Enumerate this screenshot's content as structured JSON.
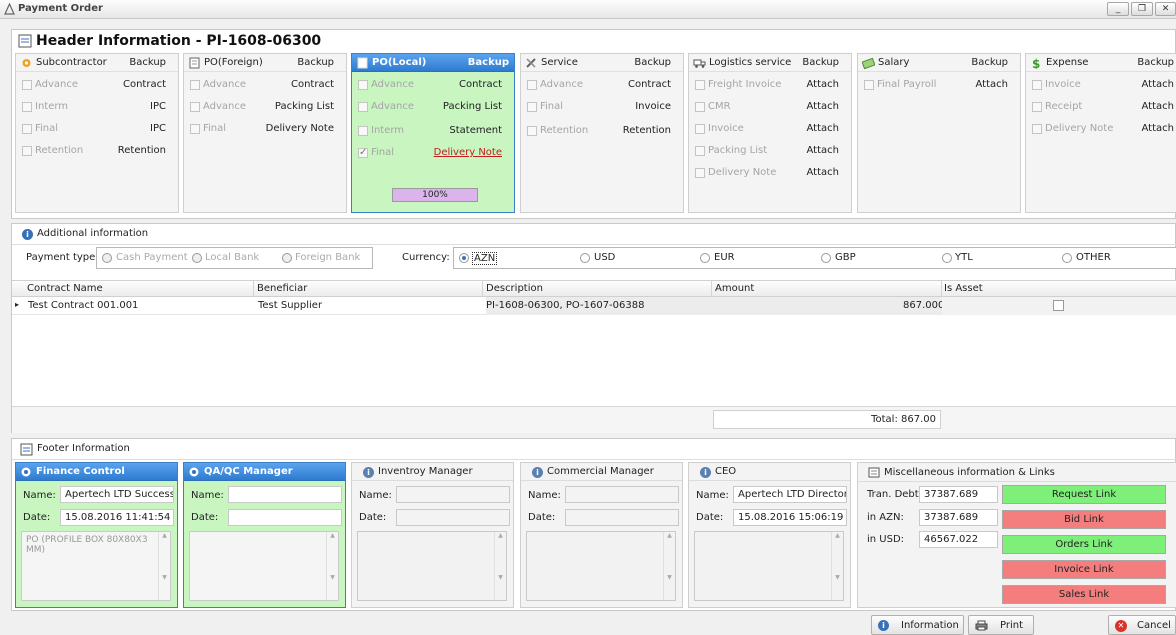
{
  "window": {
    "title": "Payment Order"
  },
  "header": {
    "title": "Header Information - PI-1608-06300"
  },
  "cards": [
    {
      "name": "Subcontractor",
      "backup": "Backup",
      "rows": [
        {
          "label": "Advance",
          "right": "Contract"
        },
        {
          "label": "Interm",
          "right": "IPC"
        },
        {
          "label": "Final",
          "right": "IPC"
        },
        {
          "label": "Retention",
          "right": "Retention"
        }
      ]
    },
    {
      "name": "PO(Foreign)",
      "backup": "Backup",
      "rows": [
        {
          "label": "Advance",
          "right": "Contract"
        },
        {
          "label": "Advance",
          "right": "Packing List"
        },
        {
          "label": "Final",
          "right": "Delivery Note"
        }
      ]
    },
    {
      "name": "PO(Local)",
      "backup": "Backup",
      "progress": "100%",
      "rows": [
        {
          "label": "Advance",
          "right": "Contract"
        },
        {
          "label": "Advance",
          "right": "Packing List"
        },
        {
          "label": "Interm",
          "right": "Statement"
        },
        {
          "label": "Final",
          "right": "Delivery Note"
        }
      ]
    },
    {
      "name": "Service",
      "backup": "Backup",
      "rows": [
        {
          "label": "Advance",
          "right": "Contract"
        },
        {
          "label": "Final",
          "right": "Invoice"
        },
        {
          "label": "Retention",
          "right": "Retention"
        }
      ]
    },
    {
      "name": "Logistics service",
      "backup": "Backup",
      "rows": [
        {
          "label": "Freight Invoice",
          "right": "Attach"
        },
        {
          "label": "CMR",
          "right": "Attach"
        },
        {
          "label": "Invoice",
          "right": "Attach"
        },
        {
          "label": "Packing List",
          "right": "Attach"
        },
        {
          "label": "Delivery Note",
          "right": "Attach"
        }
      ]
    },
    {
      "name": "Salary",
      "backup": "Backup",
      "rows": [
        {
          "label": "Final Payroll",
          "right": "Attach"
        }
      ]
    },
    {
      "name": "Expense",
      "backup": "Backup",
      "rows": [
        {
          "label": "Invoice",
          "right": "Attach"
        },
        {
          "label": "Receipt",
          "right": "Attach"
        },
        {
          "label": "Delivery Note",
          "right": "Attach"
        }
      ]
    }
  ],
  "additional": {
    "title": "Additional information",
    "payment_type_label": "Payment type:",
    "payment_types": [
      "Cash Payment",
      "Local Bank",
      "Foreign Bank"
    ],
    "currency_label": "Currency:",
    "currencies": [
      "AZN",
      "USD",
      "EUR",
      "GBP",
      "YTL",
      "OTHER"
    ],
    "selected_currency": "AZN"
  },
  "grid": {
    "columns": [
      "Contract Name",
      "Beneficiar",
      "Description",
      "Amount",
      "Is Asset"
    ],
    "rows": [
      {
        "contract": "Test Contract 001.001",
        "beneficiar": "Test Supplier",
        "description": "PI-1608-06300, PO-1607-06388",
        "amount": "867.000",
        "is_asset": false
      }
    ],
    "total": "Total: 867.00"
  },
  "footer": {
    "title": "Footer Information",
    "cards": [
      {
        "title": "Finance Control",
        "name_label": "Name:",
        "name": "Apertech LTD Success",
        "date_label": "Date:",
        "date": "15.08.2016 11:41:54",
        "memo": "PO (PROFILE BOX 80X80X3 MM)"
      },
      {
        "title": "QA/QC Manager",
        "name_label": "Name:",
        "name": "",
        "date_label": "Date:",
        "date": "",
        "memo": ""
      },
      {
        "title": "Inventroy Manager",
        "name_label": "Name:",
        "name": "",
        "date_label": "Date:",
        "date": "",
        "memo": ""
      },
      {
        "title": "Commercial Manager",
        "name_label": "Name:",
        "name": "",
        "date_label": "Date:",
        "date": "",
        "memo": ""
      },
      {
        "title": "CEO",
        "name_label": "Name:",
        "name": "Apertech LTD  Director",
        "date_label": "Date:",
        "date": "15.08.2016 15:06:19",
        "memo": ""
      }
    ],
    "misc": {
      "title": "Miscellaneous information & Links",
      "tran_debt_label": "Tran. Debt:",
      "tran_debt": "37387.689",
      "azn_label": "in AZN:",
      "azn": "37387.689",
      "usd_label": "in USD:",
      "usd": "46567.022",
      "links": [
        "Request Link",
        "Bid Link",
        "Orders Link",
        "Invoice Link",
        "Sales Link"
      ]
    }
  },
  "buttons": {
    "information": "Information",
    "print": "Print",
    "cancel": "Cancel"
  }
}
